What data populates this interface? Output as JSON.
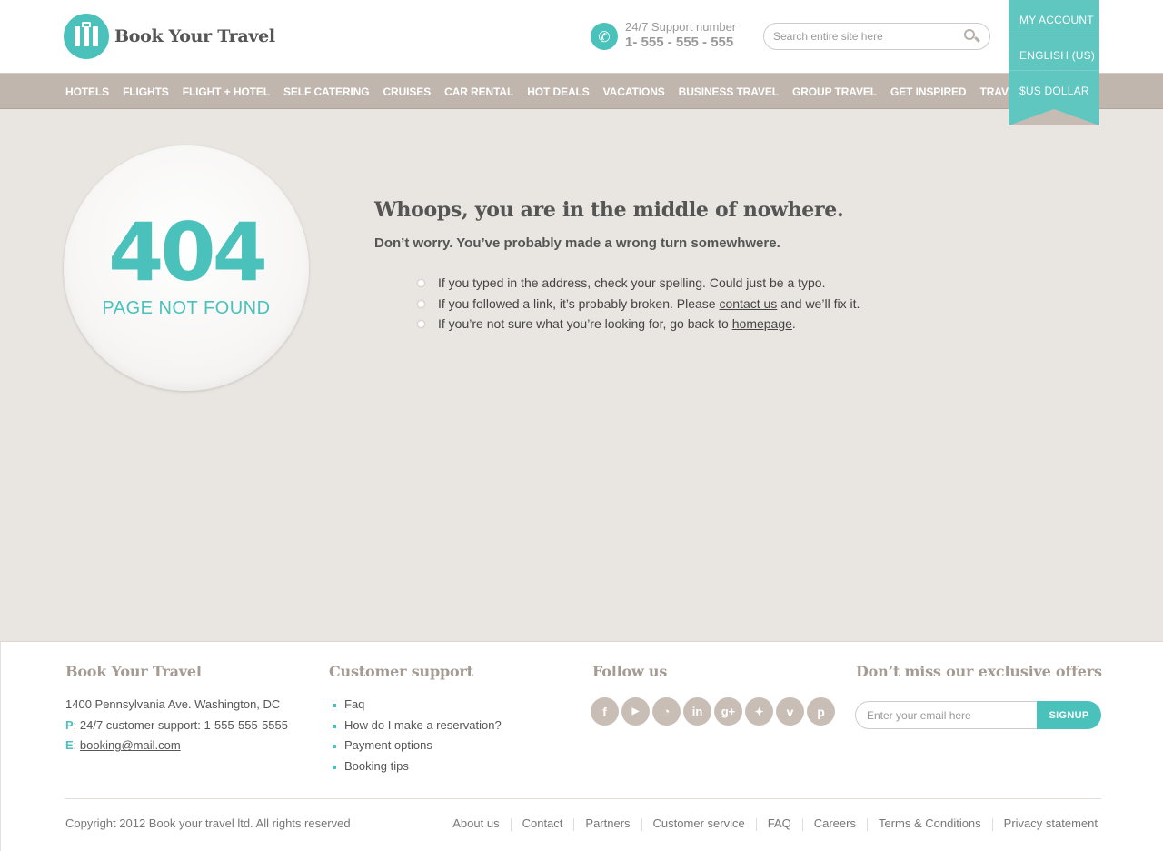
{
  "header": {
    "logo_text": "Book Your Travel",
    "support_label": "24/7 Support number",
    "support_number": "1- 555 - 555 - 555",
    "search_placeholder": "Search entire site here",
    "account_menu": [
      "MY ACCOUNT",
      "ENGLISH (US)",
      "$US DOLLAR"
    ]
  },
  "nav": {
    "items": [
      "HOTELS",
      "FLIGHTS",
      "FLIGHT + HOTEL",
      "SELF CATERING",
      "CRUISES",
      "CAR RENTAL",
      "HOT DEALS",
      "VACATIONS",
      "BUSINESS TRAVEL",
      "GROUP TRAVEL",
      "GET INSPIRED",
      "TRAVEL GUIDES"
    ]
  },
  "error": {
    "code": "404",
    "label": "PAGE NOT FOUND",
    "title": "Whoops, you are in the middle of nowhere.",
    "subtitle": "Don’t worry. You’ve probably made a wrong turn somewhwere.",
    "tip1": "If you typed in the address, check your spelling. Could just be a typo.",
    "tip2_before": "If you followed a link, it’s probably broken. Please ",
    "tip2_link": "contact us",
    "tip2_after": " and we’ll fix it.",
    "tip3_before": "If you’re not sure what you’re looking for, go back to ",
    "tip3_link": "homepage",
    "tip3_after": "."
  },
  "footer": {
    "about": {
      "title": "Book Your Travel",
      "address": "1400 Pennsylvania Ave. Washington, DC",
      "phone_key": "P",
      "phone_value": ": 24/7 customer support: 1-555-555-5555",
      "email_key": "E",
      "email_sep": ": ",
      "email_value": "booking@mail.com"
    },
    "support": {
      "title": "Customer support",
      "items": [
        "Faq",
        "How do I make a reservation?",
        "Payment options",
        "Booking tips"
      ]
    },
    "follow": {
      "title": "Follow us",
      "icons": [
        "facebook-icon",
        "youtube-icon",
        "rss-icon",
        "linkedin-icon",
        "googleplus-icon",
        "twitter-icon",
        "vimeo-icon",
        "pinterest-icon"
      ]
    },
    "offers": {
      "title": "Don’t miss our exclusive offers",
      "email_placeholder": "Enter your email here",
      "signup_label": "SIGNUP"
    },
    "copyright": "Copyright 2012 Book your travel ltd. All rights reserved",
    "links": [
      "About us",
      "Contact",
      "Partners",
      "Customer service",
      "FAQ",
      "Careers",
      "Terms & Conditions",
      "Privacy statement"
    ]
  },
  "colors": {
    "accent": "#4bc1bb",
    "nav_bg": "#c1b6ae",
    "page_bg": "#e9e5e0"
  }
}
